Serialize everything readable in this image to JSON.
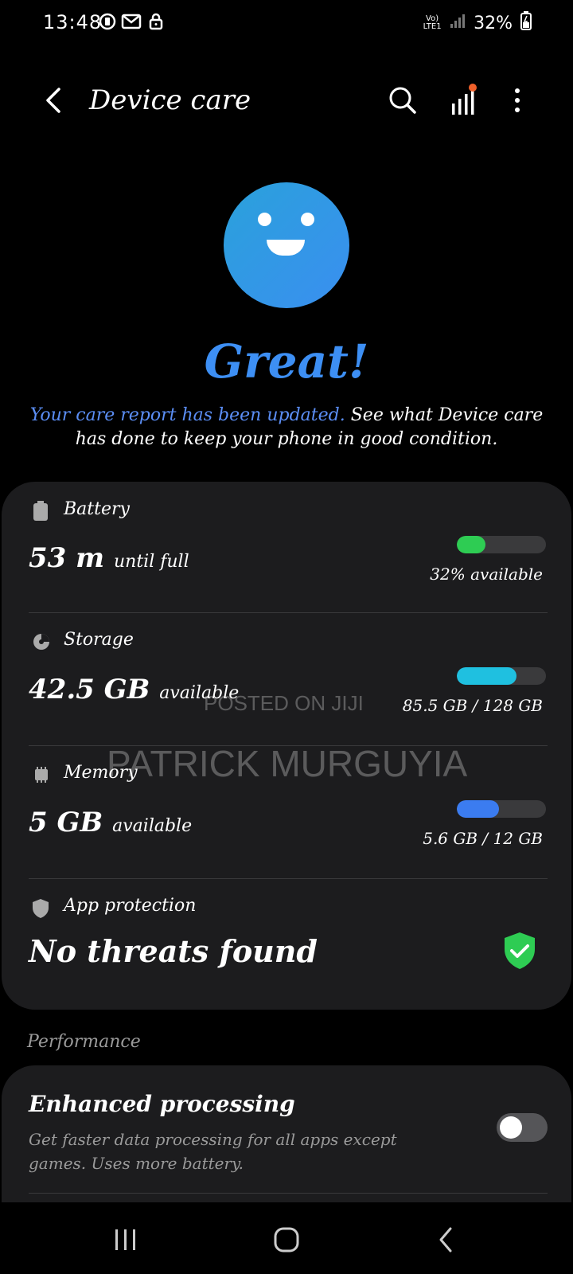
{
  "status_bar": {
    "time": "13:48",
    "network_label": "Vo) LTE1",
    "battery_percent": "32%"
  },
  "app_bar": {
    "title": "Device care"
  },
  "hero": {
    "headline": "Great!",
    "report_link": "Your care report has been updated.",
    "report_text": "See what Device care has done to keep your phone in good condition."
  },
  "battery": {
    "label": "Battery",
    "value": "53 m",
    "value_suffix": "until full",
    "info": "32% available",
    "level": 0.32,
    "color": "#2ecc53"
  },
  "storage": {
    "label": "Storage",
    "value": "42.5 GB",
    "value_suffix": "available",
    "info": "85.5 GB / 128 GB",
    "level": 0.67,
    "color": "#1fc0e0"
  },
  "memory": {
    "label": "Memory",
    "value": "5 GB",
    "value_suffix": "available",
    "info": "5.6 GB / 12 GB",
    "level": 0.47,
    "color": "#3b7cf0"
  },
  "app_protection": {
    "label": "App protection",
    "status": "No threats found",
    "color": "#2ecc53"
  },
  "watermark": {
    "line1": "POSTED ON JIJI",
    "line2": "PATRICK MURGUYIA"
  },
  "performance": {
    "header": "Performance",
    "title": "Enhanced processing",
    "description": "Get faster data processing for all apps except games. Uses more battery.",
    "toggle_on": false
  },
  "accent_color": "#3d8ff4"
}
